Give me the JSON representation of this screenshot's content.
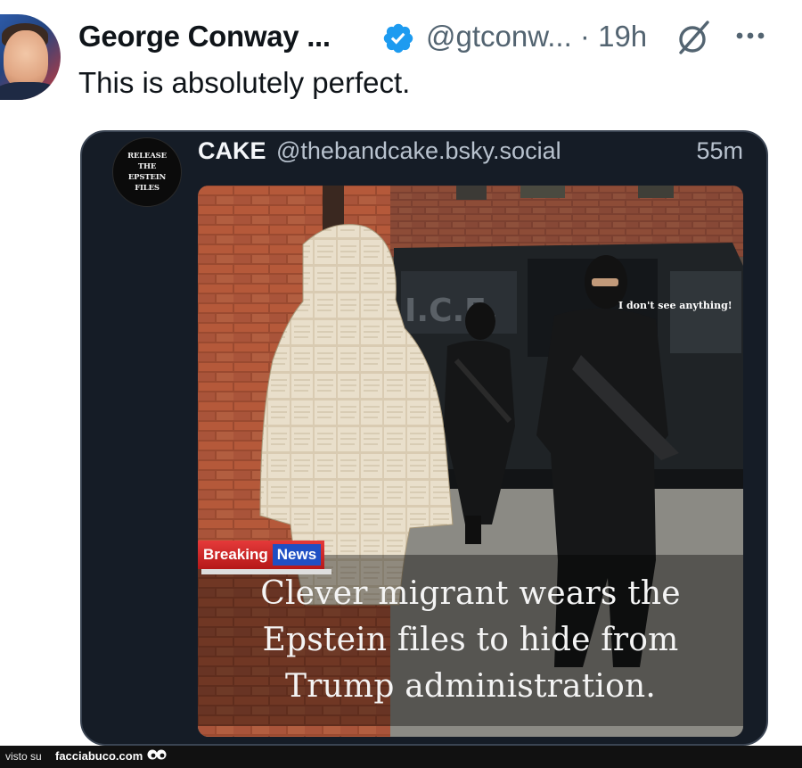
{
  "tweet": {
    "author_name": "George Conway ...",
    "handle": "@gtconw...",
    "separator": "·",
    "time": "19h",
    "text": "This is absolutely perfect.",
    "verified_color": "#1d9bf0"
  },
  "quoted_post": {
    "avatar_text": [
      "RELEASE",
      "THE",
      "EPSTEIN",
      "FILES"
    ],
    "name": "CAKE",
    "handle": "@thebandcake.bsky.social",
    "time": "55m",
    "image": {
      "van_text": "I.C.E.",
      "quote": "I don't see anything!",
      "breaking": "Breaking",
      "news": "News",
      "caption_lines": [
        "Clever migrant wears the",
        "Epstein files to hide from",
        "Trump administration."
      ]
    }
  },
  "watermark": {
    "prefix": "visto su",
    "site": "facciabuco.com"
  }
}
